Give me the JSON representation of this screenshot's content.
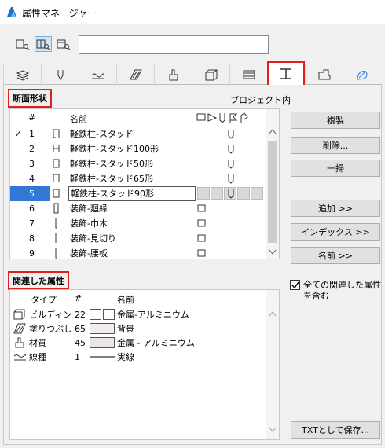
{
  "window": {
    "title": "属性マネージャー"
  },
  "search": {
    "value": ""
  },
  "section_main": {
    "label": "断面形状",
    "scope_label": "プロジェクト内"
  },
  "table": {
    "headers": {
      "num": "#",
      "name": "名前"
    },
    "rows": [
      {
        "check": "✓",
        "num": "1",
        "name": "軽鉄柱-スタッド"
      },
      {
        "check": "",
        "num": "2",
        "name": "軽鉄柱-スタッド100形"
      },
      {
        "check": "",
        "num": "3",
        "name": "軽鉄柱-スタッド50形"
      },
      {
        "check": "",
        "num": "4",
        "name": "軽鉄柱-スタッド65形"
      },
      {
        "check": "",
        "num": "5",
        "name": "軽鉄柱-スタッド90形"
      },
      {
        "check": "",
        "num": "6",
        "name": "装飾-廻縁"
      },
      {
        "check": "",
        "num": "7",
        "name": "装飾-巾木"
      },
      {
        "check": "",
        "num": "8",
        "name": "装飾-見切り"
      },
      {
        "check": "",
        "num": "9",
        "name": "装飾-腰板"
      }
    ]
  },
  "buttons": {
    "duplicate": "複製",
    "delete": "削除...",
    "purge": "一掃",
    "add": "追加 >>",
    "index": "インデックス >>",
    "name": "名前 >>",
    "save_txt": "TXTとして保存..."
  },
  "section_related": {
    "label": "関連した属性"
  },
  "include_all": {
    "label": "全ての関連した属性を含む",
    "checked": true
  },
  "assoc": {
    "headers": {
      "type": "タイプ",
      "num": "#",
      "name": "名前"
    },
    "rows": [
      {
        "type": "ビルディン",
        "num": "22",
        "name": "金属-アルミニウム"
      },
      {
        "type": "塗りつぶし",
        "num": "65",
        "name": "背景"
      },
      {
        "type": "材質",
        "num": "45",
        "name": "金属 - アルミニウム"
      },
      {
        "type": "線種",
        "num": "1",
        "name": "実線"
      }
    ]
  },
  "colors": {
    "accent_red": "#e02020",
    "selection": "#3478d6"
  }
}
